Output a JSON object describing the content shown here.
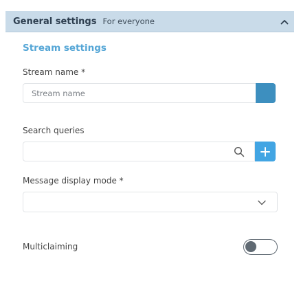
{
  "header": {
    "title": "General settings",
    "subtitle": "For everyone",
    "collapse_icon": "chevron-up-icon"
  },
  "section": {
    "title": "Stream settings"
  },
  "stream_name": {
    "label": "Stream name *",
    "placeholder": "Stream name",
    "value": "",
    "color": "#3d8fbf"
  },
  "search_queries": {
    "label": "Search queries",
    "placeholder": "",
    "value": "",
    "search_icon": "search-icon",
    "add_icon": "plus-icon"
  },
  "message_display_mode": {
    "label": "Message display mode *",
    "selected": "",
    "dropdown_icon": "chevron-down-icon"
  },
  "multiclaiming": {
    "label": "Multiclaiming",
    "enabled": false
  },
  "colors": {
    "header_bg": "#c9dbe9",
    "accent": "#42a5e3",
    "section_title": "#55a6d6"
  }
}
